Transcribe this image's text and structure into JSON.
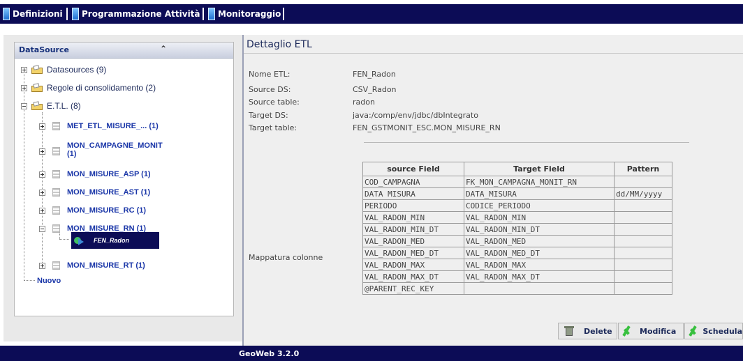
{
  "menu": {
    "items": [
      {
        "label": "Definizioni"
      },
      {
        "label": "Programmazione Attività"
      },
      {
        "label": "Monitoraggio"
      }
    ]
  },
  "sidebar": {
    "title": "DataSource",
    "collapse_glyph": "⌃",
    "tree": [
      {
        "label": "Datasources (9)",
        "icon": "folder-icon",
        "expanded": false
      },
      {
        "label": "Regole di consolidamento (2)",
        "icon": "folder-icon",
        "expanded": false
      },
      {
        "label": "E.T.L. (8)",
        "icon": "folder-icon",
        "expanded": true
      }
    ],
    "etl_items": [
      {
        "label": "MET_ETL_MISURE_... (1)"
      },
      {
        "label": "MON_CAMPAGNE_MONIT",
        "label2": "(1)"
      },
      {
        "label": "MON_MISURE_ASP (1)"
      },
      {
        "label": "MON_MISURE_AST (1)"
      },
      {
        "label": "MON_MISURE_RC (1)"
      },
      {
        "label": "MON_MISURE_RN (1)"
      },
      {
        "label": "MON_MISURE_RT (1)"
      }
    ],
    "selected_etl": "FEN_Radon",
    "new_label": "Nuovo"
  },
  "detail": {
    "title": "Dettaglio ETL",
    "fields": [
      {
        "label": "Nome ETL:",
        "value": "FEN_Radon"
      },
      {
        "label": "Source DS:",
        "value": "CSV_Radon"
      },
      {
        "label": "Source table:",
        "value": "radon"
      },
      {
        "label": "Target DS:",
        "value": "java:/comp/env/jdbc/dbIntegrato"
      },
      {
        "label": "Target table:",
        "value": "FEN_GSTMONIT_ESC.MON_MISURE_RN"
      }
    ],
    "mapping_label": "Mappatura colonne",
    "mapping_headers": [
      "source Field",
      "Target Field",
      "Pattern"
    ],
    "mapping_rows": [
      [
        "COD_CAMPAGNA",
        "FK_MON_CAMPAGNA_MONIT_RN",
        ""
      ],
      [
        "DATA MISURA",
        "DATA_MISURA",
        "dd/MM/yyyy"
      ],
      [
        "PERIODO",
        "CODICE_PERIODO",
        ""
      ],
      [
        "VAL_RADON_MIN",
        "VAL_RADON_MIN",
        ""
      ],
      [
        "VAL_RADON_MIN_DT",
        "VAL_RADON_MIN_DT",
        ""
      ],
      [
        "VAL_RADON_MED",
        "VAL_RADON_MED",
        ""
      ],
      [
        "VAL_RADON_MED_DT",
        "VAL_RADON_MED_DT",
        ""
      ],
      [
        "VAL_RADON_MAX",
        "VAL_RADON_MAX",
        ""
      ],
      [
        "VAL_RADON_MAX_DT",
        "VAL_RADON_MAX_DT",
        ""
      ],
      [
        "@PARENT_REC_KEY",
        "",
        ""
      ]
    ]
  },
  "actions": {
    "delete_label": "Delete",
    "modify_label": "Modifica",
    "schedule_label": "Schedula"
  },
  "footer": {
    "version": "GeoWeb 3.2.0"
  },
  "colors": {
    "navy": "#0c0c56",
    "link": "#1a36a8",
    "accent_green": "#38c03f"
  }
}
